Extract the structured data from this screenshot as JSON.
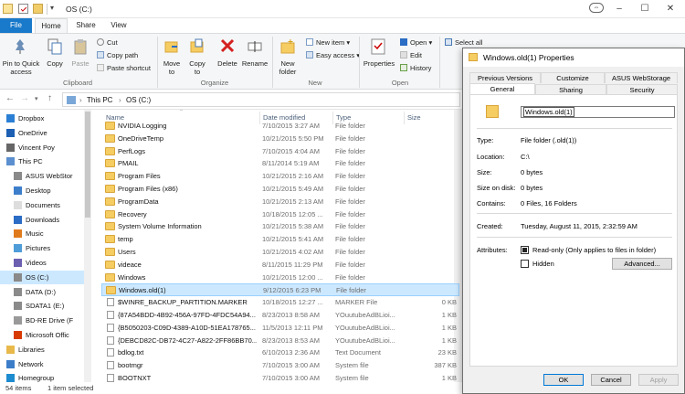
{
  "window": {
    "title": "OS (C:)"
  },
  "ribbon_tabs": [
    "File",
    "Home",
    "Share",
    "View"
  ],
  "ribbon": {
    "clipboard": {
      "pin": "Pin to Quick access",
      "copy": "Copy",
      "paste": "Paste",
      "cut": "Cut",
      "copy_path": "Copy path",
      "paste_shortcut": "Paste shortcut",
      "label": "Clipboard"
    },
    "organize": {
      "move_to": "Move to",
      "copy_to": "Copy to",
      "delete": "Delete",
      "rename": "Rename",
      "label": "Organize"
    },
    "new": {
      "new_folder": "New folder",
      "new_item": "New item",
      "easy_access": "Easy access",
      "label": "New"
    },
    "open": {
      "properties": "Properties",
      "open": "Open",
      "edit": "Edit",
      "history": "History",
      "label": "Open"
    },
    "select": {
      "select_all": "Select all"
    }
  },
  "address": {
    "crumbs": [
      "This PC",
      "OS (C:)"
    ]
  },
  "nav_items": [
    {
      "label": "Dropbox",
      "icon": "dropbox-icon"
    },
    {
      "label": "OneDrive",
      "icon": "onedrive-icon"
    },
    {
      "label": "Vincent Poy",
      "icon": "user-icon"
    },
    {
      "label": "This PC",
      "icon": "pc-icon"
    },
    {
      "label": "ASUS WebStor",
      "icon": "drive-icon"
    },
    {
      "label": "Desktop",
      "icon": "desktop-icon"
    },
    {
      "label": "Documents",
      "icon": "documents-icon"
    },
    {
      "label": "Downloads",
      "icon": "downloads-icon"
    },
    {
      "label": "Music",
      "icon": "music-icon"
    },
    {
      "label": "Pictures",
      "icon": "pictures-icon"
    },
    {
      "label": "Videos",
      "icon": "videos-icon"
    },
    {
      "label": "OS (C:)",
      "icon": "drive-icon"
    },
    {
      "label": "DATA (D:)",
      "icon": "drive-icon"
    },
    {
      "label": "SDATA1 (E:)",
      "icon": "drive-icon"
    },
    {
      "label": "BD-RE Drive (F",
      "icon": "disc-icon"
    },
    {
      "label": "Microsoft Offic",
      "icon": "office-icon"
    },
    {
      "label": "Libraries",
      "icon": "libraries-icon"
    },
    {
      "label": "Network",
      "icon": "network-icon"
    },
    {
      "label": "Homegroup",
      "icon": "homegroup-icon"
    }
  ],
  "columns": {
    "name": "Name",
    "date": "Date modified",
    "type": "Type",
    "size": "Size"
  },
  "files": [
    {
      "name": "NVIDIA Logging",
      "date": "7/10/2015 3:27 AM",
      "type": "File folder",
      "size": "",
      "kind": "folder"
    },
    {
      "name": "OneDriveTemp",
      "date": "10/21/2015 5:50 PM",
      "type": "File folder",
      "size": "",
      "kind": "folder"
    },
    {
      "name": "PerfLogs",
      "date": "7/10/2015 4:04 AM",
      "type": "File folder",
      "size": "",
      "kind": "folder"
    },
    {
      "name": "PMAIL",
      "date": "8/11/2014 5:19 AM",
      "type": "File folder",
      "size": "",
      "kind": "folder"
    },
    {
      "name": "Program Files",
      "date": "10/21/2015 2:16 AM",
      "type": "File folder",
      "size": "",
      "kind": "folder"
    },
    {
      "name": "Program Files (x86)",
      "date": "10/21/2015 5:49 AM",
      "type": "File folder",
      "size": "",
      "kind": "folder"
    },
    {
      "name": "ProgramData",
      "date": "10/21/2015 2:13 AM",
      "type": "File folder",
      "size": "",
      "kind": "folder"
    },
    {
      "name": "Recovery",
      "date": "10/18/2015 12:05 ...",
      "type": "File folder",
      "size": "",
      "kind": "folder"
    },
    {
      "name": "System Volume Information",
      "date": "10/21/2015 5:38 AM",
      "type": "File folder",
      "size": "",
      "kind": "folder"
    },
    {
      "name": "temp",
      "date": "10/21/2015 5:41 AM",
      "type": "File folder",
      "size": "",
      "kind": "folder"
    },
    {
      "name": "Users",
      "date": "10/21/2015 4:02 AM",
      "type": "File folder",
      "size": "",
      "kind": "folder"
    },
    {
      "name": "videace",
      "date": "8/11/2015 11:29 PM",
      "type": "File folder",
      "size": "",
      "kind": "folder"
    },
    {
      "name": "Windows",
      "date": "10/21/2015 12:00 ...",
      "type": "File folder",
      "size": "",
      "kind": "folder"
    },
    {
      "name": "Windows.old(1)",
      "date": "9/12/2015 6:23 PM",
      "type": "File folder",
      "size": "",
      "kind": "folder",
      "selected": true
    },
    {
      "name": "$WINRE_BACKUP_PARTITION.MARKER",
      "date": "10/18/2015 12:27 ...",
      "type": "MARKER File",
      "size": "0 KB",
      "kind": "doc"
    },
    {
      "name": "{87A54BDD-4B92-456A-97FD-4FDC54A94...",
      "date": "8/23/2013 8:58 AM",
      "type": "YOuutubeAdBLioi...",
      "size": "1 KB",
      "kind": "doc"
    },
    {
      "name": "{B5050203-C09D-4389-A10D-51EA178765...",
      "date": "11/5/2013 12:11 PM",
      "type": "YOuutubeAdBLioi...",
      "size": "1 KB",
      "kind": "doc"
    },
    {
      "name": "{DEBCD82C-DB72-4C27-A822-2FF86BB70...",
      "date": "8/23/2013 8:53 AM",
      "type": "YOuutubeAdBLioi...",
      "size": "1 KB",
      "kind": "doc"
    },
    {
      "name": "bdlog.txt",
      "date": "6/10/2013 2:36 AM",
      "type": "Text Document",
      "size": "23 KB",
      "kind": "doc"
    },
    {
      "name": "bootmgr",
      "date": "7/10/2015 3:00 AM",
      "type": "System file",
      "size": "387 KB",
      "kind": "doc"
    },
    {
      "name": "BOOTNXT",
      "date": "7/10/2015 3:00 AM",
      "type": "System file",
      "size": "1 KB",
      "kind": "doc"
    }
  ],
  "status": {
    "items": "54 items",
    "selected": "1 item selected"
  },
  "dialog": {
    "title": "Windows.old(1) Properties",
    "tabs_back": [
      "Previous Versions",
      "Customize",
      "ASUS WebStorage"
    ],
    "tabs_front": [
      "General",
      "Sharing",
      "Security"
    ],
    "name_value": "Windows.old(1)",
    "props": [
      {
        "label": "Type:",
        "value": "File folder (.old(1))"
      },
      {
        "label": "Location:",
        "value": "C:\\"
      },
      {
        "label": "Size:",
        "value": "0 bytes"
      },
      {
        "label": "Size on disk:",
        "value": "0 bytes"
      },
      {
        "label": "Contains:",
        "value": "0 Files, 16 Folders"
      }
    ],
    "created_label": "Created:",
    "created_value": "Tuesday, August 11, 2015, 2:32:59 AM",
    "attributes_label": "Attributes:",
    "readonly": "Read-only (Only applies to files in folder)",
    "hidden": "Hidden",
    "advanced": "Advanced...",
    "ok": "OK",
    "cancel": "Cancel",
    "apply": "Apply"
  }
}
